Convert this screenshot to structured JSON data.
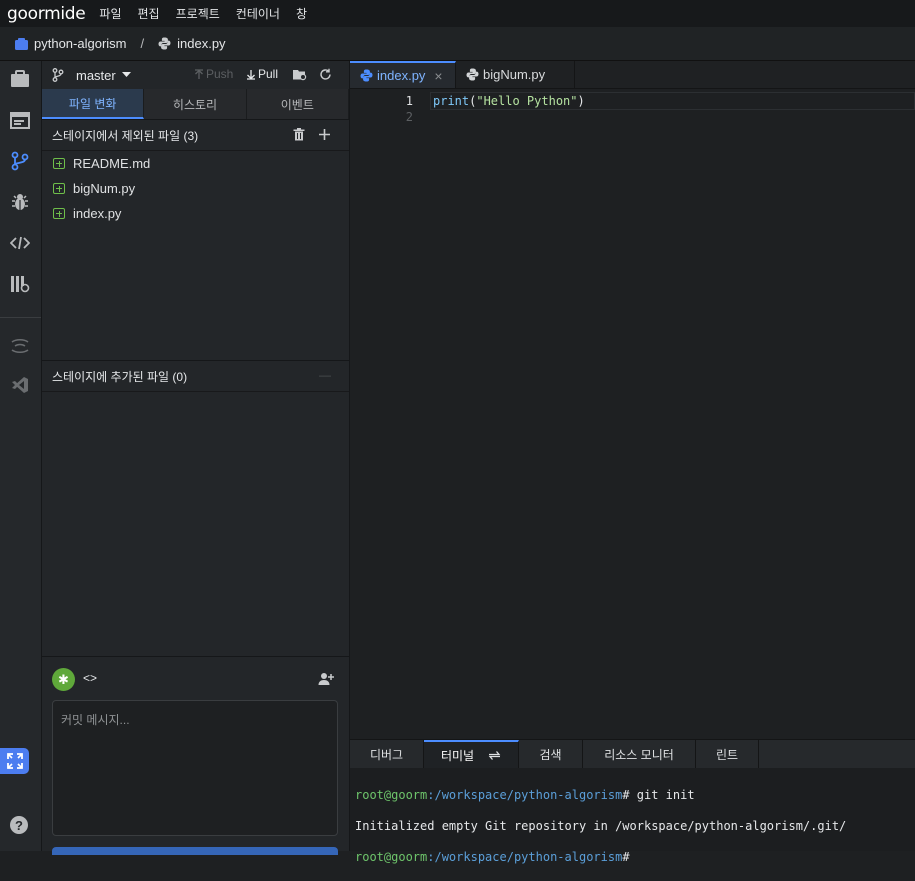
{
  "app": {
    "logo": "goormide"
  },
  "menu": [
    "파일",
    "편집",
    "프로젝트",
    "컨테이너",
    "창"
  ],
  "breadcrumb": {
    "project": "python-algorism",
    "separator": "/",
    "file": "index.py"
  },
  "scm": {
    "branch": "master",
    "push_label": "Push",
    "pull_label": "Pull",
    "tabs": [
      "파일 변화",
      "히스토리",
      "이벤트"
    ],
    "active_tab": "파일 변화",
    "unstaged_title": "스테이지에서 제외된 파일 (3)",
    "unstaged_files": [
      "README.md",
      "bigNum.py",
      "index.py"
    ],
    "staged_title": "스테이지에 추가된 파일 (0)",
    "staged_collapse": "—",
    "author_tag": "<>",
    "avatar_glyph": "✱",
    "commit_placeholder": "커밋 메시지..."
  },
  "editor": {
    "tabs": [
      {
        "label": "index.py",
        "active": true,
        "close": "×"
      },
      {
        "label": "bigNum.py",
        "active": false
      }
    ],
    "lines": [
      {
        "num": "1",
        "fn": "print",
        "open": "(",
        "str": "\"Hello Python\"",
        "close": ")"
      },
      {
        "num": "2"
      }
    ]
  },
  "bottom_panel": {
    "tabs": [
      "디버그",
      "터미널",
      "검색",
      "리소스 모니터",
      "린트"
    ],
    "active_tab": "터미널",
    "terminal": [
      {
        "user": "root@goorm",
        "path": ":/workspace/python-algorism",
        "cmd": "# git init"
      },
      {
        "output": "Initialized empty Git repository in /workspace/python-algorism/.git/"
      },
      {
        "user": "root@goorm",
        "path": ":/workspace/python-algorism",
        "cmd": "#"
      }
    ]
  },
  "colors": {
    "accent": "#4c8dff",
    "added_file": "#6fbf4a",
    "string": "#b5e2a0",
    "keyword": "#7fc8f8"
  }
}
